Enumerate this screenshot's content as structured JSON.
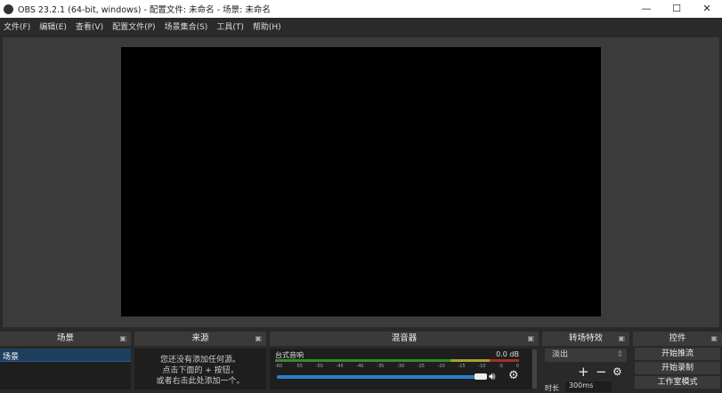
{
  "window": {
    "title": "OBS 23.2.1 (64-bit, windows) - 配置文件: 未命名 - 场景: 未命名",
    "minimize": "—",
    "maximize": "☐",
    "close": "✕"
  },
  "menu": [
    "文件(F)",
    "编辑(E)",
    "查看(V)",
    "配置文件(P)",
    "场景集合(S)",
    "工具(T)",
    "帮助(H)"
  ],
  "scenes": {
    "title": "场景",
    "items": [
      "场景"
    ]
  },
  "sources": {
    "title": "来源",
    "empty": [
      "您还没有添加任何源。",
      "点击下面的 + 按钮，",
      "或者右击此处添加一个。"
    ]
  },
  "mixer": {
    "title": "混音器",
    "channel": "台式音响",
    "level": "0.0 dB",
    "ticks": [
      "-60",
      "-55",
      "-50",
      "-45",
      "-40",
      "-35",
      "-30",
      "-25",
      "-20",
      "-15",
      "-10",
      "-5",
      "0"
    ],
    "volume_percent": 100
  },
  "transitions": {
    "title": "转场特效",
    "selected": "淡出",
    "duration_label": "时长",
    "duration": "300ms",
    "add": "+",
    "remove": "−"
  },
  "controls": {
    "title": "控件",
    "buttons": [
      "开始推流",
      "开始录制",
      "工作室模式"
    ]
  }
}
